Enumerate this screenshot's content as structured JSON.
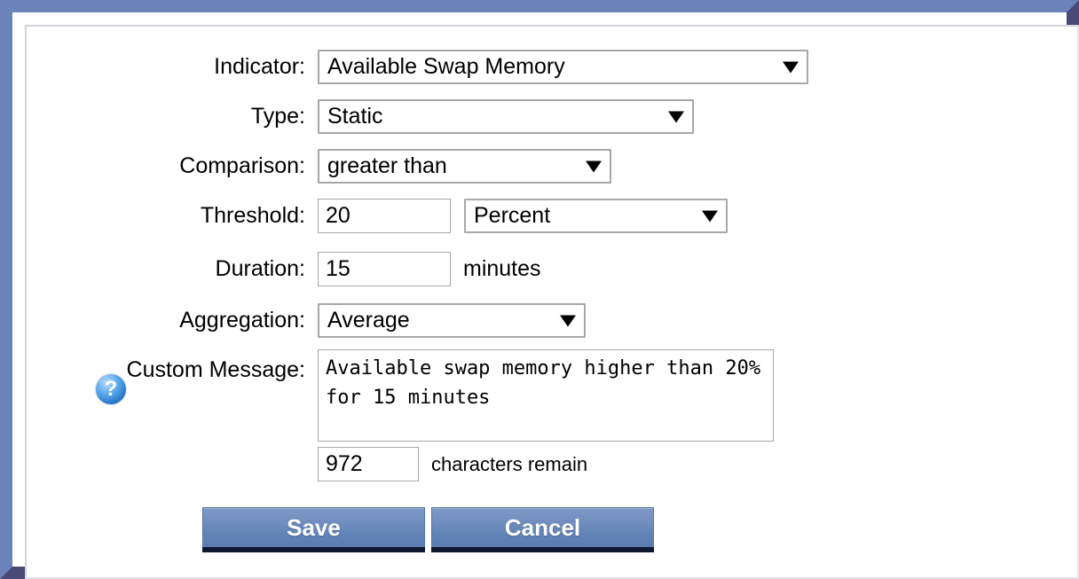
{
  "window": {
    "frame_light_color": "#6b83b8",
    "frame_dark_color": "#494a77",
    "background_color": "#ffffff"
  },
  "form": {
    "indicator": {
      "label": "Indicator:",
      "value": "Available Swap Memory",
      "arrow_icon": "chevron-down-icon"
    },
    "type": {
      "label": "Type:",
      "value": "Static",
      "arrow_icon": "chevron-down-icon"
    },
    "comparison": {
      "label": "Comparison:",
      "value": "greater than",
      "arrow_icon": "chevron-down-icon"
    },
    "threshold": {
      "label": "Threshold:",
      "value": "20",
      "unit_value": "Percent",
      "arrow_icon": "chevron-down-icon"
    },
    "duration": {
      "label": "Duration:",
      "value": "15",
      "unit_text": "minutes"
    },
    "aggregation": {
      "label": "Aggregation:",
      "value": "Average",
      "arrow_icon": "chevron-down-icon"
    },
    "custom_message": {
      "label": "Custom Message:",
      "help_icon": "?",
      "value": "Available swap memory higher than 20% for 15 minutes"
    },
    "characters_remain": {
      "value": "972",
      "text": "characters remain"
    }
  },
  "actions": {
    "save_label": "Save",
    "cancel_label": "Cancel",
    "button_color": "#6f8cbd"
  }
}
